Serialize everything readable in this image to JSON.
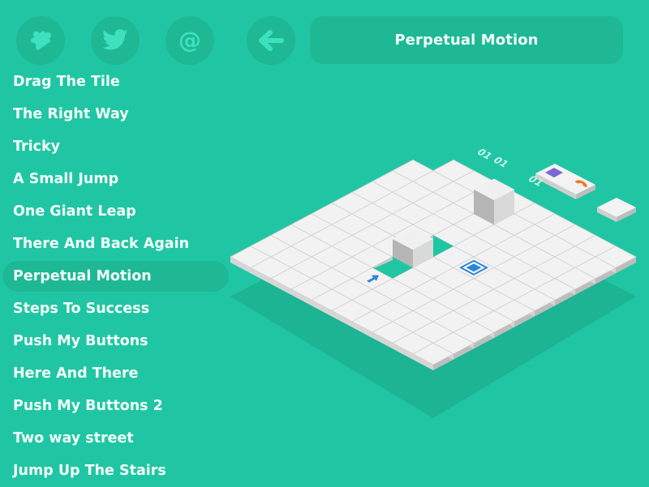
{
  "header": {
    "title": "Perpetual Motion",
    "buttons": [
      {
        "id": "puzzle",
        "icon": "puzzle-icon",
        "label": "More puzzles"
      },
      {
        "id": "twitter",
        "icon": "twitter-bird-icon",
        "label": "Twitter"
      },
      {
        "id": "email",
        "icon": "at-sign-icon",
        "label": "Contact"
      },
      {
        "id": "back",
        "icon": "arrow-left-icon",
        "label": "Back"
      }
    ]
  },
  "levels": [
    {
      "name": "Drag The Tile"
    },
    {
      "name": "The Right Way"
    },
    {
      "name": "Tricky"
    },
    {
      "name": "A Small Jump"
    },
    {
      "name": "One Giant Leap"
    },
    {
      "name": "There And Back Again"
    },
    {
      "name": "Perpetual Motion",
      "active": true
    },
    {
      "name": "Steps To Success"
    },
    {
      "name": "Push My Buttons"
    },
    {
      "name": "Here And There"
    },
    {
      "name": "Push My Buttons 2"
    },
    {
      "name": "Two way street"
    },
    {
      "name": "Jump Up The Stairs"
    }
  ],
  "board": {
    "cols": 10,
    "rows": 10,
    "missing_tiles": [
      [
        9,
        0
      ],
      [
        3,
        4
      ],
      [
        5,
        4
      ]
    ],
    "raised_blocks": [
      [
        4,
        4,
        "low"
      ],
      [
        8,
        4,
        "tall"
      ]
    ],
    "goal_tile": [
      5,
      6
    ],
    "arrow_tile": [
      2,
      4
    ],
    "tray": {
      "labels": [
        "01",
        "01",
        "01"
      ],
      "pieces": [
        "purple-square",
        "orange-semicircle"
      ]
    }
  },
  "colors": {
    "background": "#20c6a3",
    "panel": "#1eb895",
    "icon": "#3fe0be",
    "text": "#f3fffb",
    "tile_top": "#f2f2f2",
    "tile_line": "#cfcfcf",
    "tile_side": "#bdbdbd",
    "goal": "#2d86d8",
    "purple": "#7a67d8",
    "orange": "#ef7a1c",
    "shadow": "#1cb493"
  }
}
